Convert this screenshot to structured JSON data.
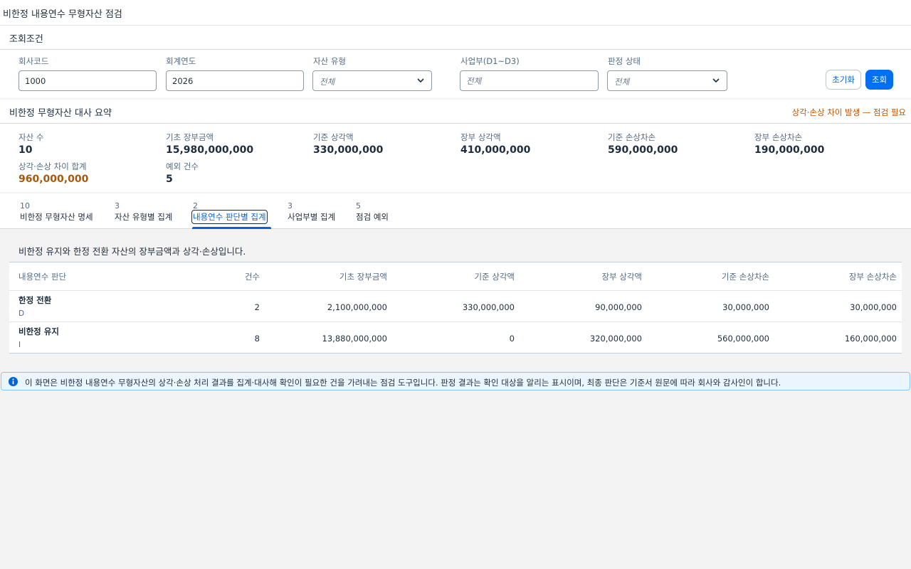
{
  "app": {
    "title": "비한정 내용연수 무형자산 점검"
  },
  "filters": {
    "section_title": "조회조건",
    "company_code": {
      "label": "회사코드",
      "value": "1000"
    },
    "fiscal_year": {
      "label": "회계연도",
      "value": "2026"
    },
    "asset_type": {
      "label": "자산 유형",
      "value": "전체"
    },
    "business_unit": {
      "label": "사업부(D1~D3)",
      "placeholder": "전체"
    },
    "judgment_status": {
      "label": "판정 상태",
      "value": "전체"
    },
    "reset_label": "초기화",
    "search_label": "조회"
  },
  "summary": {
    "section_title": "비한정 무형자산 대사 요약",
    "warning": "상각·손상 차이 발생 — 점검 필요",
    "kpis": [
      {
        "label": "자산 수",
        "value": "10"
      },
      {
        "label": "기초 장부금액",
        "value": "15,980,000,000"
      },
      {
        "label": "기준 상각액",
        "value": "330,000,000"
      },
      {
        "label": "장부 상각액",
        "value": "410,000,000"
      },
      {
        "label": "기준 손상차손",
        "value": "590,000,000"
      },
      {
        "label": "장부 손상차손",
        "value": "190,000,000"
      },
      {
        "label": "상각·손상 차이 합계",
        "value": "960,000,000"
      },
      {
        "label": "예외 건수",
        "value": "5"
      }
    ]
  },
  "tabs": [
    {
      "count": "10",
      "label": "비한정 무형자산 명세"
    },
    {
      "count": "3",
      "label": "자산 유형별 집계"
    },
    {
      "count": "2",
      "label": "내용연수 판단별 집계"
    },
    {
      "count": "3",
      "label": "사업부별 집계"
    },
    {
      "count": "5",
      "label": "점검 예외"
    }
  ],
  "active_tab": "내용연수 판단별 집계",
  "content": {
    "description": "비한정 유지와 한정 전환 자산의 장부금액과 상각·손상입니다.",
    "columns": [
      "내용연수 판단",
      "건수",
      "기초 장부금액",
      "기준 상각액",
      "장부 상각액",
      "기준 손상차손",
      "장부 손상차손"
    ],
    "rows": [
      {
        "name": "한정 전환",
        "code": "D",
        "count": "2",
        "opening": "2,100,000,000",
        "std_amort": "330,000,000",
        "book_amort": "90,000,000",
        "std_impair": "30,000,000",
        "book_impair": "30,000,000"
      },
      {
        "name": "비한정 유지",
        "code": "I",
        "count": "8",
        "opening": "13,880,000,000",
        "std_amort": "0",
        "book_amort": "320,000,000",
        "std_impair": "560,000,000",
        "book_impair": "160,000,000"
      }
    ]
  },
  "info": {
    "text": "이 화면은 비한정 내용연수 무형자산의 상각·손상 처리 결과를 집계·대사해 확인이 필요한 건을 가려내는 점검 도구입니다. 판정 결과는 확인 대상을 알리는 표시이며, 최종 판단은 기준서 원문에 따라 회사와 감사인이 합니다."
  },
  "colors": {
    "accent": "#0070f2",
    "warning": "#c35500",
    "diff_value": "#aa5808",
    "info_bg": "#ebf5fe"
  }
}
